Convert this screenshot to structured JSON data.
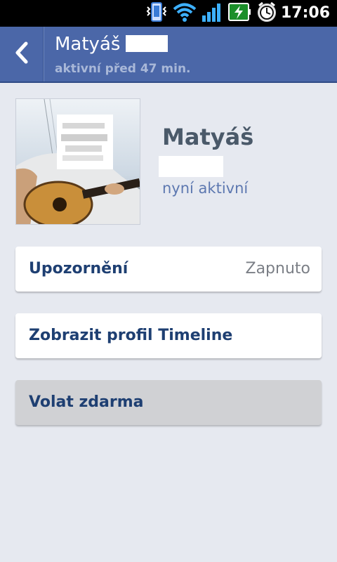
{
  "status_bar": {
    "time": "17:06",
    "icons": [
      "vibrate-icon",
      "wifi-icon",
      "signal-icon",
      "battery-charging-icon",
      "alarm-icon"
    ]
  },
  "header": {
    "back_icon": "chevron-left-icon",
    "name": "Matyáš",
    "status": "aktivní před 47 min."
  },
  "profile": {
    "first_name": "Matyáš",
    "status": "nyní aktivní"
  },
  "actions": [
    {
      "label": "Upozornění",
      "value": "Zapnuto"
    },
    {
      "label": "Zobrazit profil Timeline"
    },
    {
      "label": "Volat zdarma"
    }
  ],
  "colors": {
    "header_bg": "#4b67a8",
    "page_bg": "#e6e9f0",
    "action_text": "#1e3f72"
  }
}
